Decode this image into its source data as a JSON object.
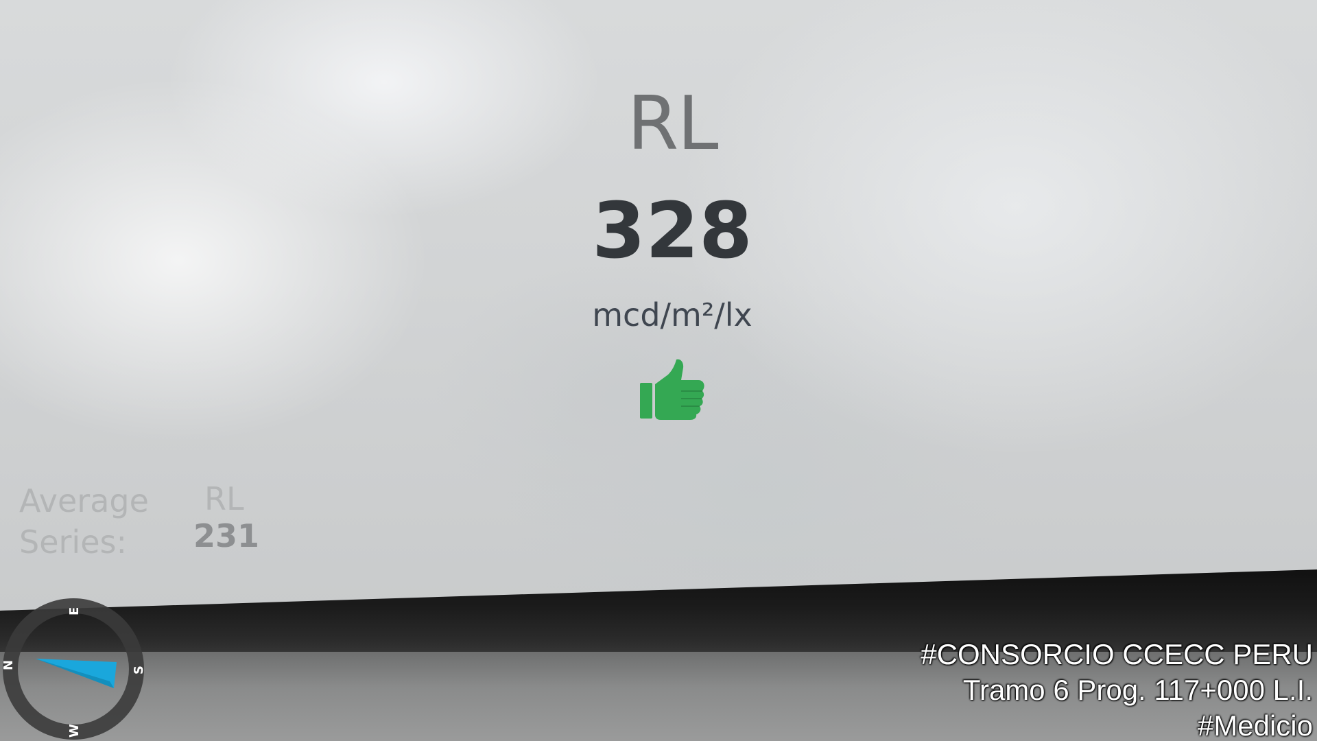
{
  "display": {
    "metric_label": "RL",
    "metric_value": "328",
    "metric_unit": "mcd/m²/lx",
    "status_icon": "thumbs-up-icon",
    "status_color": "#34a853",
    "average": {
      "label_line1": "Average",
      "label_line2": "Series:",
      "metric_label": "RL",
      "value": "231"
    }
  },
  "overlay": {
    "compass_icon": "compass-icon",
    "compass_letters": [
      "N",
      "E",
      "S",
      "W"
    ],
    "needle_color": "#1aa7dc",
    "watermark_lines": [
      "#CONSORCIO CCECC PERU",
      "Tramo 6 Prog. 117+000 L.I.",
      "#Medicio"
    ]
  }
}
